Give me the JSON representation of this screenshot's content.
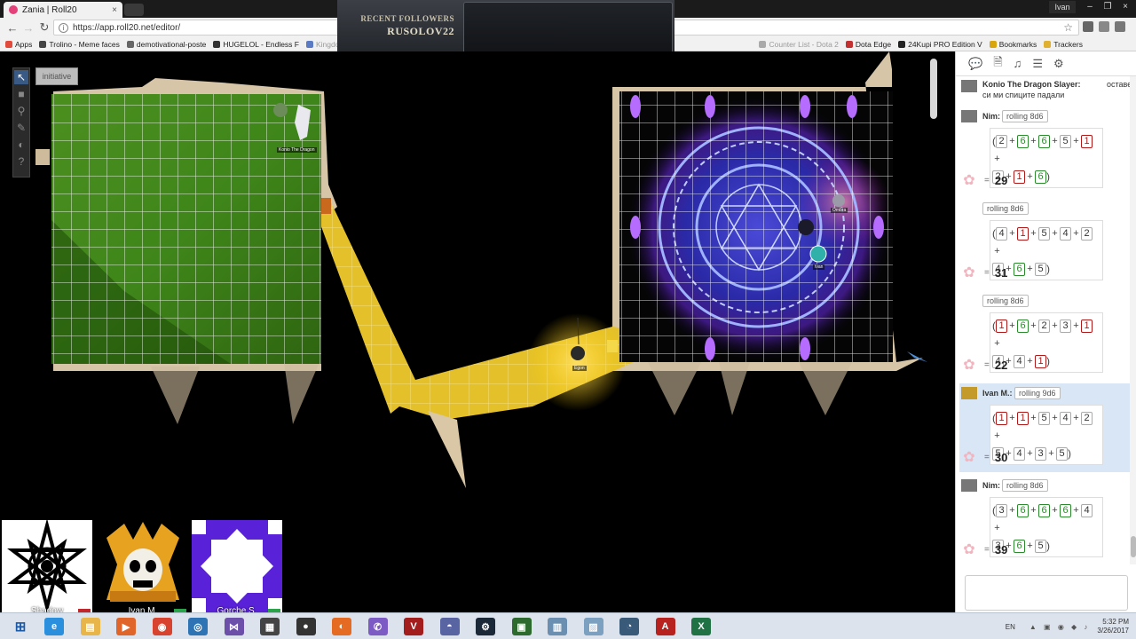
{
  "browser": {
    "tab_title": "Zania | Roll20",
    "tab_close": "×",
    "url": "https://app.roll20.net/editor/",
    "user_badge": "Ivan",
    "window_buttons": [
      "–",
      "❐",
      "×"
    ],
    "bookmarks": [
      {
        "label": "Apps",
        "color": "#e24a3b",
        "faded": false
      },
      {
        "label": "Trolino - Meme faces",
        "color": "#444444",
        "faded": false
      },
      {
        "label": "demotivational-poste",
        "color": "#666666",
        "faded": false
      },
      {
        "label": "HUGELOL - Endless F",
        "color": "#333333",
        "faded": false
      },
      {
        "label": "Kingdom of Memes",
        "color": "#5b7bc4",
        "faded": true
      }
    ],
    "bookmarks_right": [
      {
        "label": "Counter List - Dota 2",
        "color": "#aaaaaa",
        "faded": true
      },
      {
        "label": "Dota Edge",
        "color": "#c23030",
        "faded": false
      },
      {
        "label": "24Kupi PRO Edition V",
        "color": "#222222",
        "faded": false
      },
      {
        "label": "Bookmarks",
        "color": "#d8a60c",
        "faded": false
      },
      {
        "label": "Trackers",
        "color": "#e0b030",
        "faded": false
      }
    ]
  },
  "stream_overlay": {
    "label": "RECENT FOLLOWERS",
    "name": "RUSOLOV22"
  },
  "toolbar": {
    "tools": [
      {
        "name": "select-tool",
        "icon": "↖",
        "active": true
      },
      {
        "name": "shape-tool",
        "icon": "■",
        "active": false
      },
      {
        "name": "zoom-tool",
        "icon": "⚲",
        "active": false
      },
      {
        "name": "draw-tool",
        "icon": "✎",
        "active": false
      },
      {
        "name": "fog-tool",
        "icon": "◐",
        "active": false
      },
      {
        "name": "help-tool",
        "icon": "?",
        "active": false
      }
    ],
    "initiative_label": "initiative"
  },
  "map": {
    "token_labels": {
      "konio": "Konio The Dragon",
      "egon": "Egon",
      "ombra": "Ombra",
      "ivan": "Ivan"
    }
  },
  "players": [
    {
      "name": "Shadow",
      "status_color": "#c0262c"
    },
    {
      "name": "Ivan M.",
      "status_color": "#2aa34a"
    },
    {
      "name": "Gorche S.",
      "status_color": "#2aa34a"
    }
  ],
  "sidebar": {
    "tab_icons": [
      "💬",
      "🗎",
      "♫",
      "☰",
      "⚙"
    ],
    "messages": [
      {
        "type": "text",
        "sender": "Konio The Dragon Slayer:",
        "text_line1": "оставете",
        "text_line2": "си ми спиците падали"
      },
      {
        "type": "roll",
        "sender": "Nim:",
        "formula": "rolling 8d6",
        "dice": [
          2,
          6,
          6,
          5,
          1,
          2,
          1,
          6
        ],
        "total": "29",
        "highlight": false
      },
      {
        "type": "roll",
        "sender": "",
        "formula": "rolling 8d6",
        "dice": [
          4,
          1,
          5,
          4,
          2,
          4,
          6,
          5
        ],
        "total": "31",
        "highlight": false
      },
      {
        "type": "roll",
        "sender": "",
        "formula": "rolling 8d6",
        "dice": [
          1,
          6,
          2,
          3,
          1,
          4,
          4,
          1
        ],
        "total": "22",
        "highlight": false
      },
      {
        "type": "roll",
        "sender": "Ivan M.:",
        "formula": "rolling 9d6",
        "dice": [
          1,
          1,
          5,
          4,
          2,
          5,
          4,
          3,
          5
        ],
        "total": "30",
        "highlight": true
      },
      {
        "type": "roll",
        "sender": "Nim:",
        "formula": "rolling 8d6",
        "dice": [
          3,
          6,
          6,
          6,
          4,
          3,
          6,
          5
        ],
        "total": "39",
        "highlight": false
      }
    ],
    "equals_sign": "="
  },
  "taskbar": {
    "apps": [
      {
        "name": "ie-icon",
        "color": "#2a8fdc",
        "glyph": "e"
      },
      {
        "name": "explorer-icon",
        "color": "#e7b54a",
        "glyph": "▤"
      },
      {
        "name": "media-icon",
        "color": "#e0652a",
        "glyph": "▶"
      },
      {
        "name": "chrome-icon",
        "color": "#d8432f",
        "glyph": "◉"
      },
      {
        "name": "app-icon",
        "color": "#2e74b5",
        "glyph": "◎"
      },
      {
        "name": "vs-icon",
        "color": "#6b4fa8",
        "glyph": "⋈"
      },
      {
        "name": "calc-icon",
        "color": "#444444",
        "glyph": "▦"
      },
      {
        "name": "obs-icon",
        "color": "#333333",
        "glyph": "●"
      },
      {
        "name": "firefox-icon",
        "color": "#e56b22",
        "glyph": "◐"
      },
      {
        "name": "viber-icon",
        "color": "#7c5cc4",
        "glyph": "✆"
      },
      {
        "name": "voicemeeter-icon",
        "color": "#a31d1d",
        "glyph": "V"
      },
      {
        "name": "discord-icon",
        "color": "#5865a2",
        "glyph": "◓"
      },
      {
        "name": "steam-icon",
        "color": "#1b2838",
        "glyph": "⚙"
      },
      {
        "name": "terminal-icon",
        "color": "#2d6a2d",
        "glyph": "▣"
      },
      {
        "name": "notes-icon",
        "color": "#6b8fb0",
        "glyph": "▥"
      },
      {
        "name": "photos-icon",
        "color": "#7ba0c0",
        "glyph": "▨"
      },
      {
        "name": "teamspeak-icon",
        "color": "#3a5a7a",
        "glyph": "◔"
      },
      {
        "name": "acrobat-icon",
        "color": "#b8221e",
        "glyph": "A"
      },
      {
        "name": "excel-icon",
        "color": "#207245",
        "glyph": "X"
      }
    ],
    "lang": "EN",
    "time": "5:32 PM",
    "date": "3/26/2017"
  }
}
